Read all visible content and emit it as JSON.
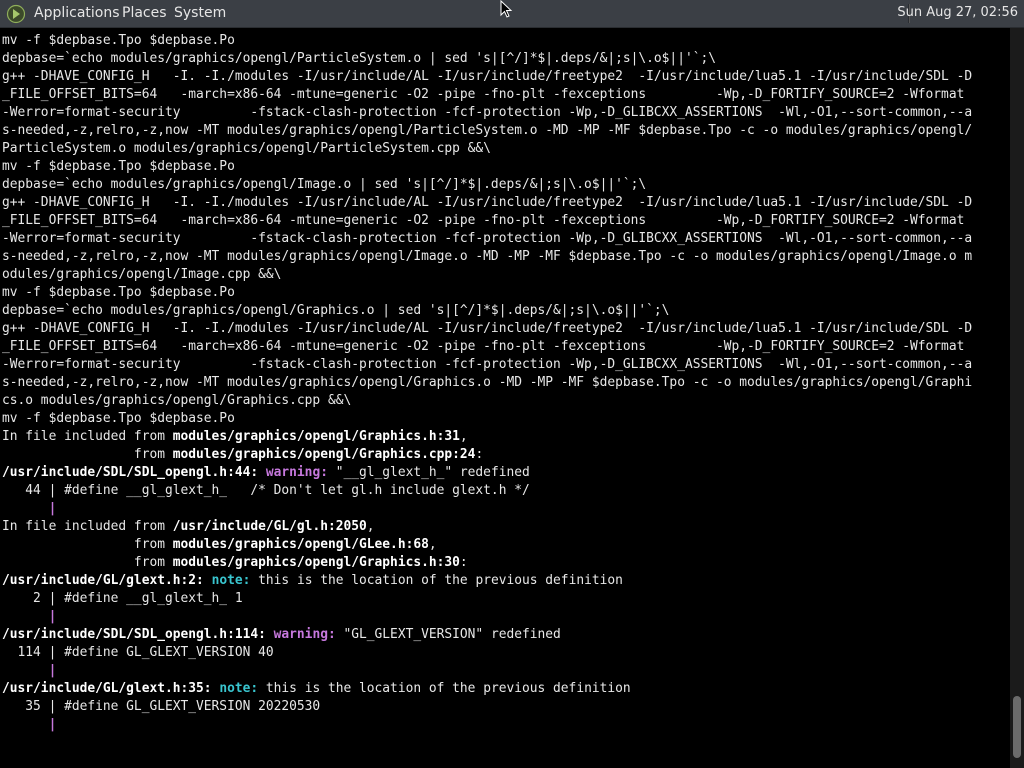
{
  "topbar": {
    "menus": [
      "Applications",
      "Places",
      "System"
    ],
    "clock": "Sun Aug 27, 02:56"
  },
  "terminal": {
    "lines": [
      "mv -f $depbase.Tpo $depbase.Po",
      "depbase=`echo modules/graphics/opengl/ParticleSystem.o | sed 's|[^/]*$|.deps/&|;s|\\.o$||'`;\\",
      "g++ -DHAVE_CONFIG_H   -I. -I./modules -I/usr/include/AL -I/usr/include/freetype2  -I/usr/include/lua5.1 -I/usr/include/SDL -D",
      "_FILE_OFFSET_BITS=64   -march=x86-64 -mtune=generic -O2 -pipe -fno-plt -fexceptions         -Wp,-D_FORTIFY_SOURCE=2 -Wformat",
      "-Werror=format-security         -fstack-clash-protection -fcf-protection -Wp,-D_GLIBCXX_ASSERTIONS  -Wl,-O1,--sort-common,--a",
      "s-needed,-z,relro,-z,now -MT modules/graphics/opengl/ParticleSystem.o -MD -MP -MF $depbase.Tpo -c -o modules/graphics/opengl/",
      "ParticleSystem.o modules/graphics/opengl/ParticleSystem.cpp &&\\",
      "mv -f $depbase.Tpo $depbase.Po",
      "depbase=`echo modules/graphics/opengl/Image.o | sed 's|[^/]*$|.deps/&|;s|\\.o$||'`;\\",
      "g++ -DHAVE_CONFIG_H   -I. -I./modules -I/usr/include/AL -I/usr/include/freetype2  -I/usr/include/lua5.1 -I/usr/include/SDL -D",
      "_FILE_OFFSET_BITS=64   -march=x86-64 -mtune=generic -O2 -pipe -fno-plt -fexceptions         -Wp,-D_FORTIFY_SOURCE=2 -Wformat",
      "-Werror=format-security         -fstack-clash-protection -fcf-protection -Wp,-D_GLIBCXX_ASSERTIONS  -Wl,-O1,--sort-common,--a",
      "s-needed,-z,relro,-z,now -MT modules/graphics/opengl/Image.o -MD -MP -MF $depbase.Tpo -c -o modules/graphics/opengl/Image.o m",
      "odules/graphics/opengl/Image.cpp &&\\",
      "mv -f $depbase.Tpo $depbase.Po",
      "depbase=`echo modules/graphics/opengl/Graphics.o | sed 's|[^/]*$|.deps/&|;s|\\.o$||'`;\\",
      "g++ -DHAVE_CONFIG_H   -I. -I./modules -I/usr/include/AL -I/usr/include/freetype2  -I/usr/include/lua5.1 -I/usr/include/SDL -D",
      "_FILE_OFFSET_BITS=64   -march=x86-64 -mtune=generic -O2 -pipe -fno-plt -fexceptions         -Wp,-D_FORTIFY_SOURCE=2 -Wformat",
      "-Werror=format-security         -fstack-clash-protection -fcf-protection -Wp,-D_GLIBCXX_ASSERTIONS  -Wl,-O1,--sort-common,--a",
      "s-needed,-z,relro,-z,now -MT modules/graphics/opengl/Graphics.o -MD -MP -MF $depbase.Tpo -c -o modules/graphics/opengl/Graphi",
      "cs.o modules/graphics/opengl/Graphics.cpp &&\\",
      "mv -f $depbase.Tpo $depbase.Po",
      "In file included from modules/graphics/opengl/Graphics.h:31,",
      "                 from modules/graphics/opengl/Graphics.cpp:24:",
      "/usr/include/SDL/SDL_opengl.h:44: warning: \"__gl_glext_h_\" redefined",
      "   44 | #define __gl_glext_h_   /* Don't let gl.h include glext.h */",
      "      |",
      "In file included from /usr/include/GL/gl.h:2050,",
      "                 from modules/graphics/opengl/GLee.h:68,",
      "                 from modules/graphics/opengl/Graphics.h:30:",
      "/usr/include/GL/glext.h:2: note: this is the location of the previous definition",
      "    2 | #define __gl_glext_h_ 1",
      "      |",
      "/usr/include/SDL/SDL_opengl.h:114: warning: \"GL_GLEXT_VERSION\" redefined",
      "  114 | #define GL_GLEXT_VERSION 40",
      "      |",
      "/usr/include/GL/glext.h:35: note: this is the location of the previous definition",
      "   35 | #define GL_GLEXT_VERSION 20220530",
      "      |"
    ]
  },
  "colors": {
    "warning": "#c678dd",
    "note": "#39c5cf"
  },
  "icons": {
    "logo": "distro-logo-icon",
    "cursor": "mouse-pointer-icon"
  }
}
